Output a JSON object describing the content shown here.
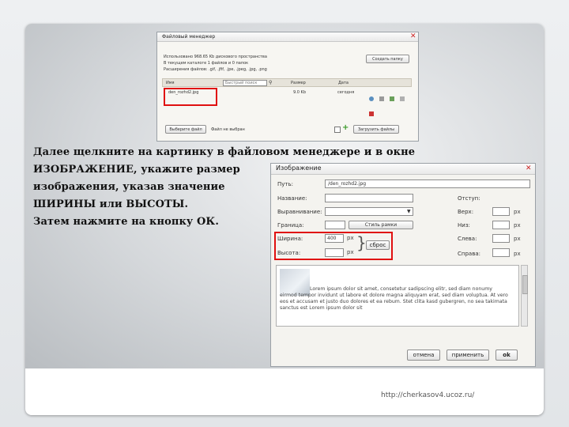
{
  "file_manager": {
    "title": "Файловый менеджер",
    "info_line1": "Использовано 968.65 Kb дискового пространства",
    "info_line2": "В текущем каталоге 1 файлов и 0 папок",
    "info_line3": "Расширения файлов: .gif, .jfif, .jpe, .jpeg, .jpg, .png",
    "create_folder_btn": "Создать папку",
    "col_name": "Имя",
    "search_placeholder": "Быстрый поиск",
    "col_size": "Размер",
    "col_date": "Дата",
    "file_name": "den_rozhd2.jpg",
    "file_size": "9.0 Kb",
    "file_date": "сегодня",
    "choose_file_btn": "Выберите файл",
    "no_file_text": "Файл не выбран",
    "upload_btn": "Загрузить файлы"
  },
  "instruction": {
    "line1": "Далее щелкните на картинку в файловом менеджере и в окне",
    "line2": "ИЗОБРАЖЕНИЕ, укажите размер",
    "line3": "изображения, указав значение",
    "line4": "ШИРИНЫ или ВЫСОТЫ.",
    "line5": "Затем нажмите на кнопку ОК."
  },
  "image_dialog": {
    "title": "Изображение",
    "path_label": "Путь:",
    "path_value": "/den_rozhd2.jpg",
    "name_label": "Название:",
    "align_label": "Выравнивание:",
    "border_label": "Граница:",
    "border_style_btn": "Стиль рамки",
    "width_label": "Ширина:",
    "width_value": "400",
    "height_label": "Высота:",
    "height_value": "",
    "unit_px": "px",
    "reset_btn": "сброс",
    "indent_label": "Отступ:",
    "top_label": "Верх:",
    "bottom_label": "Низ:",
    "left_label": "Слева:",
    "right_label": "Справа:",
    "preview_text": "Lorem ipsum dolor sit amet, consetetur sadipscing elitr, sed diam nonumy eirmod tempor invidunt ut labore et dolore magna aliquyam erat, sed diam voluptua. At vero eos et accusam et justo duo dolores et ea rebum. Stet clita kasd gubergren, no sea takimata sanctus est Lorem ipsum dolor sit",
    "cancel_btn": "отмена",
    "apply_btn": "применить",
    "ok_btn": "ok"
  },
  "footer": {
    "url": "http://cherkasov4.ucoz.ru/"
  },
  "colors": {
    "highlight_red": "#e01010",
    "dialog_bg": "#f4f3ef"
  }
}
